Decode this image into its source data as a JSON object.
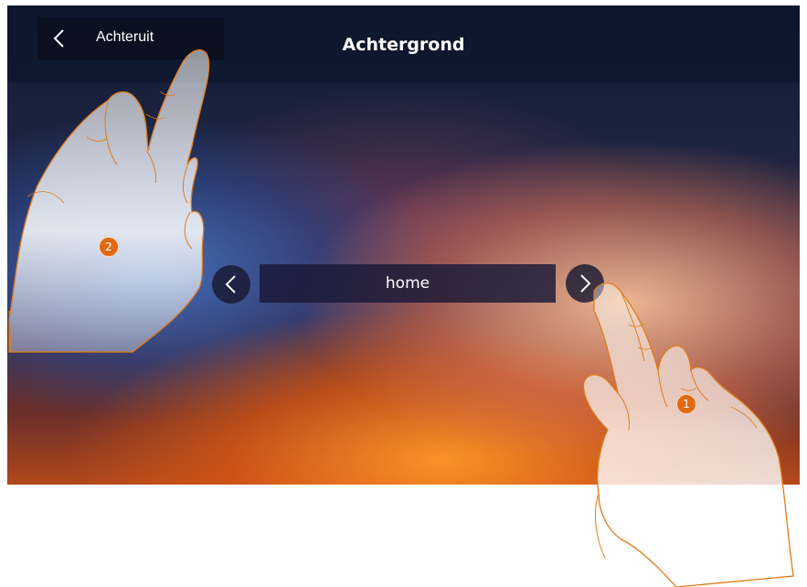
{
  "header": {
    "back_label": "Achteruit",
    "title": "Achtergrond"
  },
  "selector": {
    "value": "home"
  },
  "steps": {
    "first": "1",
    "second": "2"
  },
  "icons": {
    "back": "chevron-left-icon",
    "prev": "chevron-left-icon",
    "next": "chevron-right-icon",
    "hand": "pointing-hand-icon"
  },
  "colors": {
    "step_badge": "#e06a14",
    "hand_outline": "#e07b1a"
  }
}
